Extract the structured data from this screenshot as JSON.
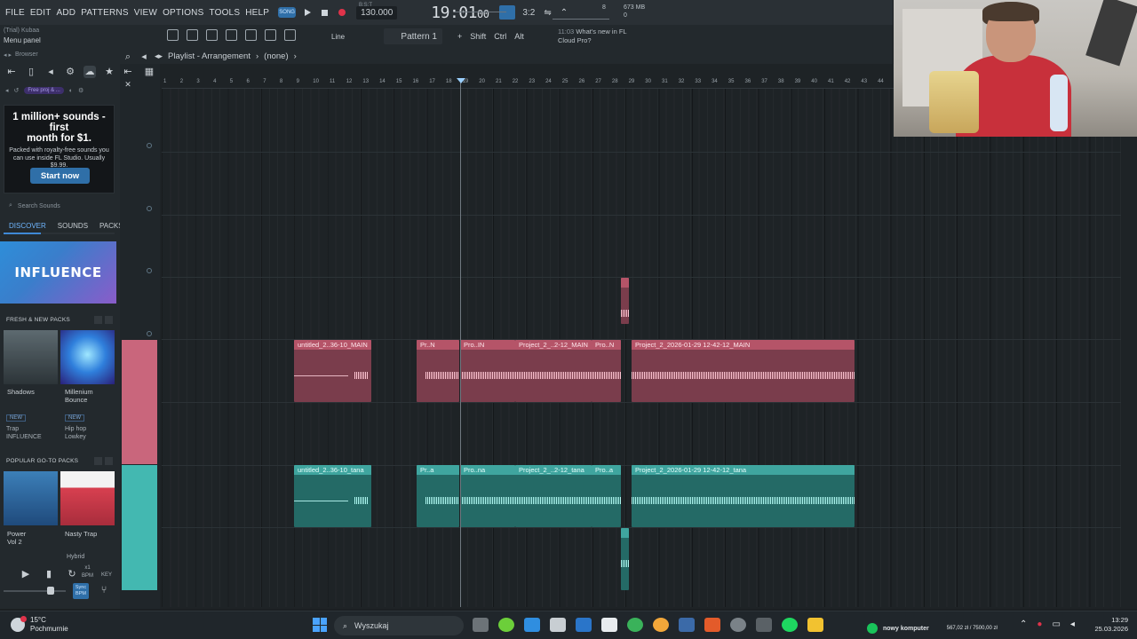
{
  "menu": [
    "FILE",
    "EDIT",
    "ADD",
    "PATTERNS",
    "VIEW",
    "OPTIONS",
    "TOOLS",
    "HELP"
  ],
  "transport": {
    "mode": "SONG",
    "tempo": "130.000",
    "time": "19:01",
    "time_sub": "00",
    "bars_beats": "B:S:T",
    "stepper": "3:2"
  },
  "cpu": {
    "val1": "8",
    "mem": "673 MB",
    "val2": "0"
  },
  "toolbar": {
    "trial": "(Trial) Kubaa",
    "menu_panel": "Menu panel",
    "snap": "Line",
    "pattern": "Pattern 1",
    "mods": [
      "Shift",
      "Ctrl",
      "Alt"
    ]
  },
  "news": {
    "time": "11:03",
    "text1": "What's new in FL",
    "text2": "Cloud Pro?"
  },
  "browser": {
    "header": "Browser",
    "free_pill": "Free proj & ...",
    "ad": {
      "title1": "1 million+ sounds - first",
      "title2": "month for $1.",
      "body1": "Packed with royalty-free sounds you",
      "body2": "can use inside FL Studio. Usually",
      "body3": "$9.99.",
      "button": "Start now"
    },
    "search": "Search Sounds",
    "tabs": [
      "DISCOVER",
      "SOUNDS",
      "PACKS"
    ],
    "banner": "INFLUENCE",
    "fresh_header": "FRESH & NEW PACKS",
    "fresh": [
      {
        "name": "Shadows",
        "tag": "NEW",
        "genre1": "Trap",
        "genre2": "INFLUENCE"
      },
      {
        "name": "Millenium Bounce",
        "name2": "Bounce",
        "tag": "NEW",
        "genre1": "Hip hop",
        "genre2": "Lowkey"
      }
    ],
    "popular_header": "POPULAR GO-TO PACKS",
    "popular": [
      {
        "name": "Power",
        "name2": "Vol 2"
      },
      {
        "name": "Nasty Trap",
        "genre1": "Hybrid"
      }
    ],
    "bpm": "BPM",
    "key": "KEY",
    "rate": "x1",
    "sync": "Sync BPM"
  },
  "playlist": {
    "title": "Playlist - Arrangement",
    "pattern_sel": "(none)",
    "ruler": [
      "1",
      "2",
      "3",
      "4",
      "5",
      "6",
      "7",
      "8",
      "9",
      "10",
      "11",
      "12",
      "13",
      "14",
      "15",
      "16",
      "17",
      "18",
      "19",
      "20",
      "21",
      "22",
      "23",
      "24",
      "25",
      "26",
      "27",
      "28",
      "29",
      "30",
      "31",
      "32",
      "33",
      "34",
      "35",
      "36",
      "37",
      "38",
      "39",
      "40",
      "41",
      "42",
      "43",
      "44"
    ],
    "main_clips": [
      "untitled_2..36-10_MAIN",
      "Pr..N",
      "Pro..IN",
      "Project_2_..2-12_MAIN",
      "Pro..N",
      "Project_2_2026-01-29 12-42-12_MAIN"
    ],
    "tana_clips": [
      "untitled_2..36-10_tana",
      "Pr..a",
      "Pro..na",
      "Project_2_..2-12_tana",
      "Pro..a",
      "Project_2_2026-01-29 12-42-12_tana"
    ]
  },
  "taskbar": {
    "temp": "15°C",
    "weather": "Pochmurnie",
    "search": "Wyszukaj",
    "tray_app": "nowy komputer",
    "tray_value": "567,02 zł / 7500,00 zł",
    "time": "13:29",
    "date": "25.03.2026"
  },
  "colors": {
    "pink_clip": "#b55468",
    "teal_clip": "#3fa59f",
    "accent": "#2f6fa8"
  }
}
